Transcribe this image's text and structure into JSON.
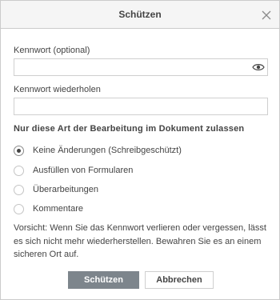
{
  "dialog": {
    "title": "Schützen",
    "close_icon": "close-icon"
  },
  "password": {
    "label": "Kennwort (optional)",
    "value": "",
    "placeholder": "",
    "toggle_icon": "eye-icon"
  },
  "repeat": {
    "label": "Kennwort wiederholen",
    "value": "",
    "placeholder": ""
  },
  "edit_restriction": {
    "heading": "Nur diese Art der Bearbeitung im Dokument zulassen",
    "selected": "Keine Änderungen (Schreibgeschützt)",
    "options": [
      {
        "label": "Keine Änderungen (Schreibgeschützt)",
        "checked": true
      },
      {
        "label": "Ausfüllen von Formularen",
        "checked": false
      },
      {
        "label": "Überarbeitungen",
        "checked": false
      },
      {
        "label": "Kommentare",
        "checked": false
      }
    ]
  },
  "warning": "Vorsicht: Wenn Sie das Kennwort verlieren oder vergessen, lässt es sich nicht mehr wiederherstellen. Bewahren Sie es an einem sicheren Ort auf.",
  "buttons": {
    "protect": "Schützen",
    "cancel": "Abbrechen"
  },
  "colors": {
    "primary_button": "#7d858c",
    "header_bg": "#f5f5f5",
    "border": "#cbcbcb",
    "text": "#444444"
  }
}
